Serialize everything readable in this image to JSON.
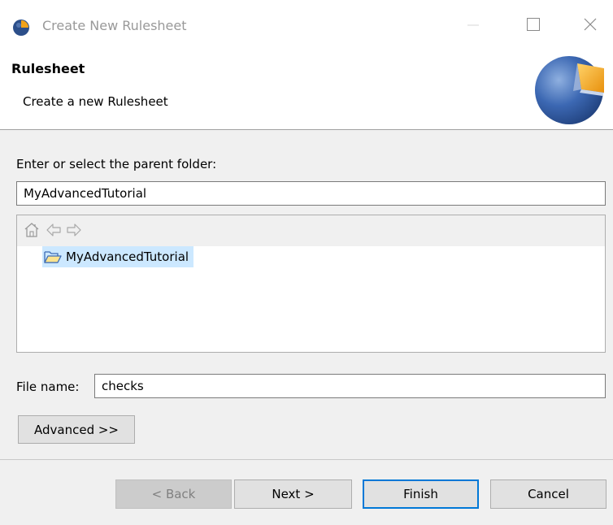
{
  "window": {
    "title": "Create New Rulesheet",
    "icon": "eclipse-globe-icon",
    "controls": [
      "minimize-icon",
      "maximize-icon",
      "close-icon"
    ]
  },
  "banner": {
    "heading": "Rulesheet",
    "description": "Create a new Rulesheet",
    "logo": "rulesheet-globe-logo"
  },
  "parent_folder": {
    "label": "Enter or select the parent folder:",
    "value": "MyAdvancedTutorial"
  },
  "tree": {
    "toolbar": [
      "home-icon",
      "back-arrow-icon",
      "forward-arrow-icon"
    ],
    "items": [
      {
        "label": "MyAdvancedTutorial",
        "icon": "open-folder-icon",
        "selected": true
      }
    ]
  },
  "file_name": {
    "label": "File name:",
    "value": "checks"
  },
  "buttons": {
    "advanced": "Advanced >>",
    "back": "< Back",
    "next": "Next >",
    "finish": "Finish",
    "cancel": "Cancel"
  },
  "colors": {
    "selection": "#cce8ff",
    "default_button_border": "#0078d7",
    "logo_blue": "#2f5fa8",
    "logo_orange": "#f2a31a"
  }
}
